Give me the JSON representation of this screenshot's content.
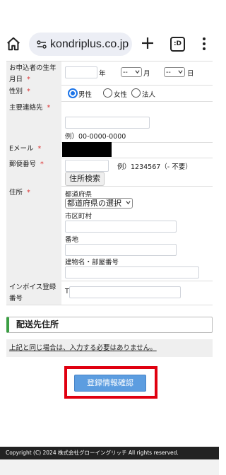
{
  "browser": {
    "url": "kondriplus.co.jp",
    "tab_count": ":D"
  },
  "form": {
    "birthdate": {
      "label": "お申込者の生年月日",
      "year_unit": "年",
      "month_value": "--",
      "month_unit": "月",
      "day_value": "--",
      "day_unit": "日"
    },
    "gender": {
      "label": "性別",
      "options": [
        "男性",
        "女性",
        "法人"
      ],
      "selected": "男性"
    },
    "phone": {
      "label": "主要連絡先",
      "example": "例）00-0000-0000"
    },
    "email": {
      "label": "Eメール"
    },
    "postal": {
      "label": "郵便番号",
      "example": "例）1234567（- 不要）",
      "search_button": "住所検索"
    },
    "address": {
      "label": "住所",
      "prefecture_label": "都道府県",
      "prefecture_select": "都道府県の選択",
      "city_label": "市区町村",
      "street_label": "番地",
      "building_label": "建物名・部屋番号"
    },
    "invoice": {
      "label": "インボイス登録番号",
      "prefix": "T"
    },
    "required_mark": "*"
  },
  "shipping": {
    "title": "配送先住所",
    "note": "上記と同じ場合は、入力する必要はありません。"
  },
  "confirm_button": "登録情報確認",
  "footer": "Copyright (C) 2024 株式会社グローイングリッチ All rights reserved."
}
